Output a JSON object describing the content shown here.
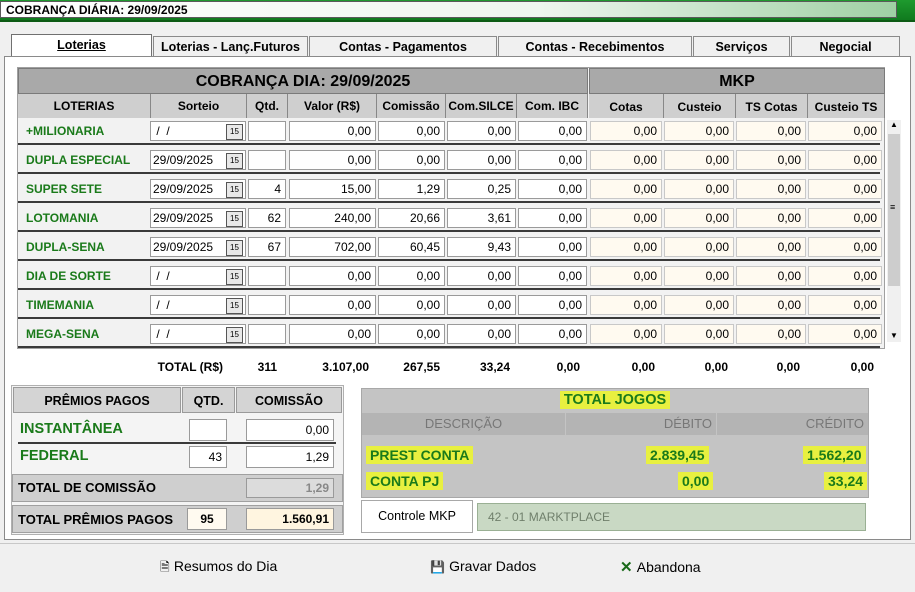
{
  "window": {
    "title": "COBRANÇA DIÁRIA: 29/09/2025"
  },
  "tabs": [
    {
      "label": "Loterias"
    },
    {
      "label": "Loterias - Lanç.Futuros"
    },
    {
      "label": "Contas - Pagamentos"
    },
    {
      "label": "Contas - Recebimentos"
    },
    {
      "label": "Serviços"
    },
    {
      "label": "Negocial"
    }
  ],
  "grid": {
    "title": "COBRANÇA DIA: 29/09/2025",
    "mkp_title": "MKP",
    "columns": [
      "LOTERIAS",
      "Sorteio",
      "Qtd.",
      "Valor (R$)",
      "Comissão",
      "Com.SILCE",
      "Com. IBC"
    ],
    "mkp_columns": [
      "Cotas",
      "Custeio",
      "TS Cotas",
      "Custeio TS"
    ],
    "date_icon": "calendar-icon",
    "rows": [
      {
        "name": "+MILIONARIA",
        "date": " /  /",
        "qtd": "",
        "valor": "0,00",
        "comissao": "0,00",
        "silce": "0,00",
        "ibc": "0,00",
        "cotas": "0,00",
        "custeio": "0,00",
        "ts_cotas": "0,00",
        "custeio_ts": "0,00"
      },
      {
        "name": "DUPLA ESPECIAL",
        "date": "29/09/2025",
        "qtd": "",
        "valor": "0,00",
        "comissao": "0,00",
        "silce": "0,00",
        "ibc": "0,00",
        "cotas": "0,00",
        "custeio": "0,00",
        "ts_cotas": "0,00",
        "custeio_ts": "0,00"
      },
      {
        "name": "SUPER SETE",
        "date": "29/09/2025",
        "qtd": "4",
        "valor": "15,00",
        "comissao": "1,29",
        "silce": "0,25",
        "ibc": "0,00",
        "cotas": "0,00",
        "custeio": "0,00",
        "ts_cotas": "0,00",
        "custeio_ts": "0,00"
      },
      {
        "name": "LOTOMANIA",
        "date": "29/09/2025",
        "qtd": "62",
        "valor": "240,00",
        "comissao": "20,66",
        "silce": "3,61",
        "ibc": "0,00",
        "cotas": "0,00",
        "custeio": "0,00",
        "ts_cotas": "0,00",
        "custeio_ts": "0,00"
      },
      {
        "name": "DUPLA-SENA",
        "date": "29/09/2025",
        "qtd": "67",
        "valor": "702,00",
        "comissao": "60,45",
        "silce": "9,43",
        "ibc": "0,00",
        "cotas": "0,00",
        "custeio": "0,00",
        "ts_cotas": "0,00",
        "custeio_ts": "0,00"
      },
      {
        "name": "DIA DE SORTE",
        "date": " /  /",
        "qtd": "",
        "valor": "0,00",
        "comissao": "0,00",
        "silce": "0,00",
        "ibc": "0,00",
        "cotas": "0,00",
        "custeio": "0,00",
        "ts_cotas": "0,00",
        "custeio_ts": "0,00"
      },
      {
        "name": "TIMEMANIA",
        "date": " /  /",
        "qtd": "",
        "valor": "0,00",
        "comissao": "0,00",
        "silce": "0,00",
        "ibc": "0,00",
        "cotas": "0,00",
        "custeio": "0,00",
        "ts_cotas": "0,00",
        "custeio_ts": "0,00"
      },
      {
        "name": "MEGA-SENA",
        "date": " /  /",
        "qtd": "",
        "valor": "0,00",
        "comissao": "0,00",
        "silce": "0,00",
        "ibc": "0,00",
        "cotas": "0,00",
        "custeio": "0,00",
        "ts_cotas": "0,00",
        "custeio_ts": "0,00"
      }
    ],
    "totals": {
      "label": "TOTAL (R$)",
      "qtd": "311",
      "valor": "3.107,00",
      "comissao": "267,55",
      "silce": "33,24",
      "ibc": "0,00",
      "cotas": "0,00",
      "custeio": "0,00",
      "ts_cotas": "0,00",
      "custeio_ts": "0,00"
    }
  },
  "premios": {
    "headers": [
      "PRÊMIOS PAGOS",
      "QTD.",
      "COMISSÃO"
    ],
    "rows": [
      {
        "label": "INSTANTÂNEA",
        "qtd": "",
        "comissao": "0,00"
      },
      {
        "label": "FEDERAL",
        "qtd": "43",
        "comissao": "1,29"
      }
    ],
    "total_comissao_label": "TOTAL DE COMISSÃO",
    "total_comissao_value": "1,29",
    "total_premios_label": "TOTAL PRÊMIOS PAGOS",
    "total_premios_qtd": "95",
    "total_premios_value": "1.560,91"
  },
  "total_jogos": {
    "title": "TOTAL JOGOS",
    "headers": [
      "DESCRIÇÃO",
      "DÉBITO",
      "CRÉDITO"
    ],
    "rows": [
      {
        "desc": "PREST CONTA",
        "debito": "2.839,45",
        "credito": "1.562,20"
      },
      {
        "desc": "CONTA PJ",
        "debito": "0,00",
        "credito": "33,24"
      }
    ],
    "controle_button": "Controle MKP",
    "marketplace": "42 - 01 MARKTPLACE"
  },
  "footer": {
    "resumos": "Resumos do Dia",
    "gravar": "Gravar Dados",
    "abandona": "Abandona"
  },
  "colors": {
    "title_green": "#1a9a2a",
    "label_green": "#1a7a1a",
    "highlight": "#e8f040"
  }
}
